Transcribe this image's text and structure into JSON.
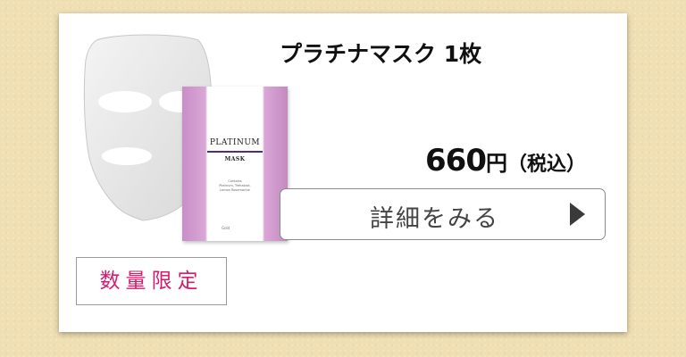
{
  "product": {
    "title": "プラチナマスク 1枚",
    "price_value": "660",
    "price_currency": "円",
    "price_tax": "（税込）",
    "details_button": "詳細をみる",
    "badge": "数量限定"
  },
  "package": {
    "title": "PLATINUM",
    "subtitle": "MASK",
    "small_lines": [
      "Contains",
      "Platinum, Trehalose,",
      "Lemon Rosemarine"
    ],
    "brand": "Gold"
  },
  "colors": {
    "badge_text": "#d81b6e",
    "package_lilac": "#c98ec7",
    "background": "#efdfb3"
  },
  "icons": {
    "details_arrow": "play-triangle-icon"
  }
}
